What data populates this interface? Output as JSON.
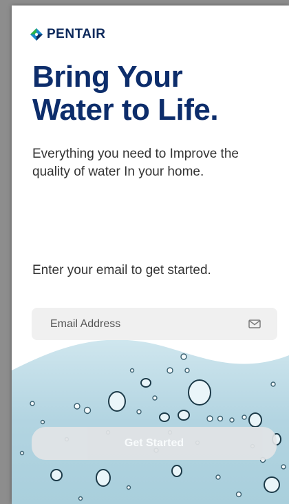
{
  "brand": {
    "name": "PENTAIR",
    "logo_icon": "pentair-logo-icon"
  },
  "hero": {
    "headline_line1": "Bring Your",
    "headline_line2": "Water to Life.",
    "subtitle": "Everything you need to Improve the quality of water In your home."
  },
  "signup": {
    "prompt": "Enter your email to get started.",
    "email_placeholder": "Email Address",
    "email_value": "",
    "email_icon": "mail-icon",
    "button_label": "Get Started"
  },
  "colors": {
    "brand_navy": "#0d2d6b",
    "logo_green": "#2bb34a",
    "logo_blue": "#1a8ad0",
    "water": "#bcd9e4"
  }
}
